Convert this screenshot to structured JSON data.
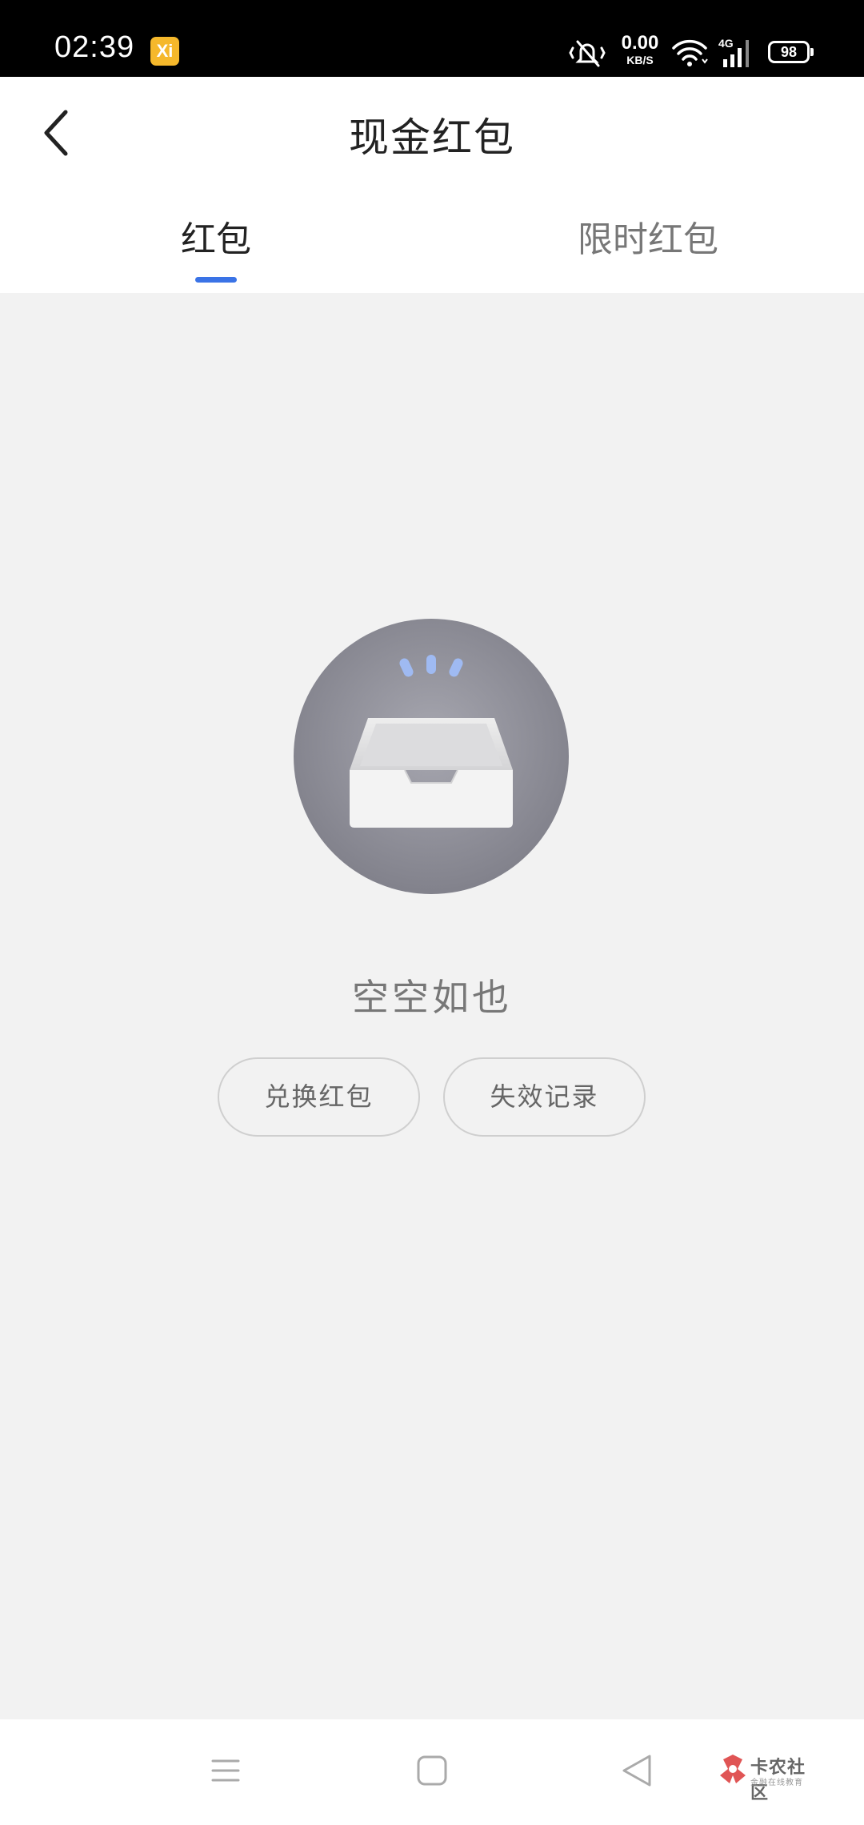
{
  "status_bar": {
    "time": "02:39",
    "app_badge": "Xi",
    "net_speed_value": "0.00",
    "net_speed_unit": "KB/S",
    "network_type": "4G",
    "battery": "98"
  },
  "header": {
    "title": "现金红包"
  },
  "tabs": [
    {
      "label": "红包",
      "active": true
    },
    {
      "label": "限时红包",
      "active": false
    }
  ],
  "empty_state": {
    "message": "空空如也",
    "buttons": [
      {
        "label": "兑换红包"
      },
      {
        "label": "失效记录"
      }
    ]
  },
  "watermark": {
    "text": "卡农社区",
    "subtext": "金融在线教育"
  },
  "colors": {
    "accent": "#3a73e6",
    "background": "#f2f2f2",
    "circle": "#8e8e96"
  }
}
